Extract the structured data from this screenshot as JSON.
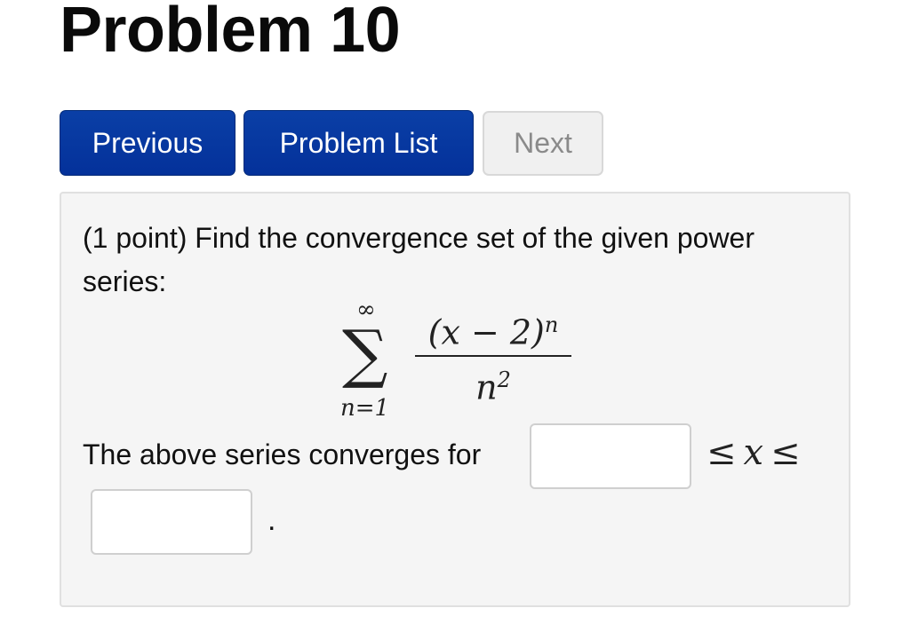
{
  "page": {
    "title": "Problem 10"
  },
  "nav": {
    "previous_label": "Previous",
    "problem_list_label": "Problem List",
    "next_label": "Next"
  },
  "problem": {
    "text": "(1 point) Find the convergence set of the given power series:",
    "formula": {
      "sum_upper": "∞",
      "sum_symbol": "∑",
      "sum_lower": "n=1",
      "numerator_base": "(x − 2)",
      "numerator_exponent": "n",
      "denominator_base": "n",
      "denominator_exponent": "2"
    },
    "answer_prompt": "The above series converges for",
    "lower_bound_value": "",
    "upper_bound_value": "",
    "inequality_left": "≤",
    "inequality_var": "x",
    "inequality_right": "≤",
    "trailing_period": "."
  },
  "colors": {
    "primary_button": "#04319a",
    "disabled_button": "#f0f0f0",
    "panel_background": "#f5f5f5"
  }
}
